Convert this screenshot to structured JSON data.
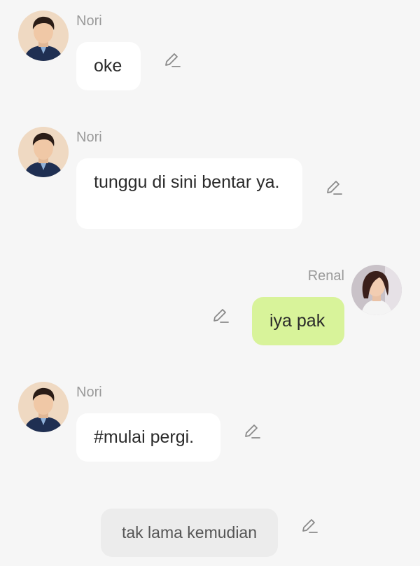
{
  "colors": {
    "background": "#f6f6f6",
    "other_bubble": "#ffffff",
    "self_bubble": "#d8f39a",
    "narration_bubble": "#ececec",
    "name_text": "#9a9a9a",
    "edit_icon": "#8a8a8a"
  },
  "messages": [
    {
      "sender": "Nori",
      "text": "oke",
      "side": "left",
      "avatar_icon": "nori-avatar",
      "action_icon": "edit-pencil-icon"
    },
    {
      "sender": "Nori",
      "text": "tunggu di sini bentar ya.",
      "side": "left",
      "avatar_icon": "nori-avatar",
      "action_icon": "edit-pencil-icon"
    },
    {
      "sender": "Renal",
      "text": "iya pak",
      "side": "right",
      "avatar_icon": "renal-avatar",
      "action_icon": "edit-pencil-icon"
    },
    {
      "sender": "Nori",
      "text": "#mulai pergi.",
      "side": "left",
      "avatar_icon": "nori-avatar",
      "action_icon": "edit-pencil-icon"
    }
  ],
  "narration": {
    "text": "tak lama kemudian",
    "action_icon": "edit-pencil-icon"
  }
}
